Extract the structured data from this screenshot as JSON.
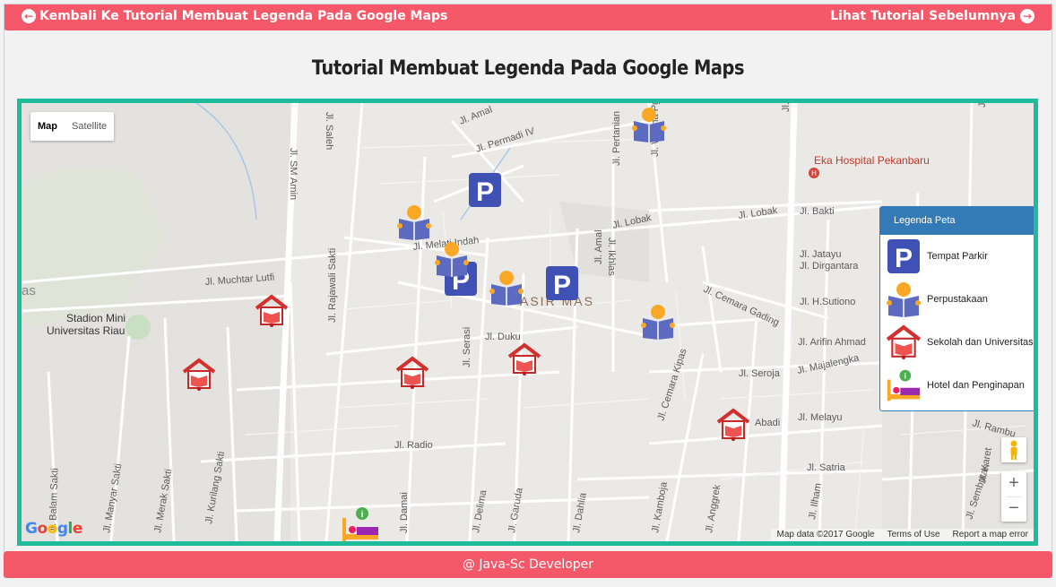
{
  "header": {
    "back_label": "Kembali Ke Tutorial Membuat Legenda Pada Google Maps",
    "prev_label": "Lihat Tutorial Sebelumnya"
  },
  "page_title": "Tutorial Membuat Legenda Pada Google Maps",
  "map": {
    "type_controls": {
      "map": "Map",
      "satellite": "Satellite"
    },
    "street_labels": [
      "Jl. Amal",
      "Jl. Permadi IV",
      "Jl. SM Amin",
      "Jl. Soekarno - H",
      "Eka Hospital Pekanbaru",
      "Jl. Bakti VI",
      "Jl. Pertanian",
      "Jl. Wisma Pgri",
      "Jl. Lobak",
      "Jl. Lobak",
      "Jl. Bakti",
      "Jl. Melati Indah",
      "Jl. Muchtar Lutfi",
      "Jl. Jatayu",
      "Jl. Dirgantara",
      "Jl. H.Sutiono",
      "Jl. Cemara Gading",
      "Jl. Arifin Ahmad",
      "Jl. Majalengka",
      "Jl. Seroja",
      "Jl. Melayu",
      "Jl. Satria",
      "Jl. Radio",
      "Jl. Duku",
      "Jl. Serasi",
      "Jl. Rajawali Sakti",
      "Jl. Kurilang Sakti",
      "Jl. Merak Sakti",
      "Jl. Manyar Sakti",
      "Jl. Balam Sakti",
      "Jl. Delima",
      "Jl. Garuda",
      "Jl. Dahlia",
      "Jl. Kamboja",
      "Jl. Anggrek",
      "Jl. Damai",
      "Jl. Cemara Kipas",
      "Jl. Abadi",
      "Jl. Rambu",
      "Jl. Sembutan",
      "Jl. Karet",
      "Jl. Amal",
      "Jl. Ikhlas",
      "Jl. Ilham",
      "Jl. Saleh"
    ],
    "area_labels": {
      "stadium": "Stadion Mini\nUniversitas Riau",
      "district": "ASIR MAS",
      "edge": "as"
    },
    "attribution": {
      "data": "Map data ©2017 Google",
      "terms": "Terms of Use",
      "report": "Report a map error"
    },
    "logo": [
      "G",
      "o",
      "o",
      "g",
      "l",
      "e"
    ],
    "zoom": {
      "in": "+",
      "out": "−"
    }
  },
  "legend": {
    "title": "Legenda Peta",
    "items": [
      {
        "label": "Tempat Parkir",
        "icon": "parking-icon"
      },
      {
        "label": "Perpustakaan",
        "icon": "library-icon"
      },
      {
        "label": "Sekolah dan Universitas",
        "icon": "school-icon"
      },
      {
        "label": "Hotel dan Penginapan",
        "icon": "hotel-icon"
      }
    ]
  },
  "footer": {
    "text": "@ Java-Sc Developer"
  },
  "colors": {
    "accent": "#f55868",
    "map_border": "#1fbc9c",
    "legend_header": "#337ab7",
    "parking": "#3f51b5"
  }
}
